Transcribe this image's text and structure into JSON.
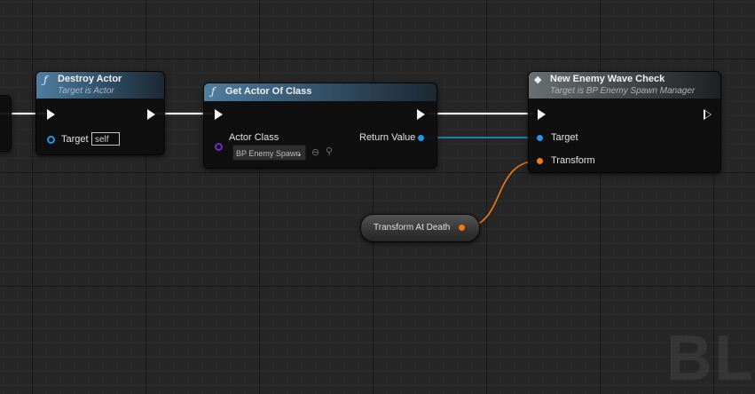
{
  "nodes": {
    "destroy_actor": {
      "icon": "ƒ",
      "title": "Destroy Actor",
      "subtitle": "Target is Actor",
      "target_label": "Target",
      "target_value": "self"
    },
    "get_actor_of_class": {
      "icon": "ƒ",
      "title": "Get Actor Of Class",
      "actor_class_label": "Actor Class",
      "actor_class_value": "BP Enemy Spawn",
      "return_label": "Return Value"
    },
    "new_enemy_wave_check": {
      "icon": "◆",
      "title": "New Enemy Wave Check",
      "subtitle": "Target is BP Enemy Spawn Manager",
      "target_label": "Target",
      "transform_label": "Transform"
    },
    "transform_at_death": {
      "label": "Transform At Death"
    }
  },
  "watermark": "BLU",
  "colors": {
    "exec_wire": "#f2f2f2",
    "object_wire": "#1d9be8",
    "transform_wire": "#f47a14",
    "function_header": "#4f7ea1",
    "class_pin": "#6a2fc4"
  },
  "icons": [
    "function-icon",
    "macro-icon",
    "dropdown-chevron-icon",
    "use-selected-icon",
    "browse-icon"
  ]
}
